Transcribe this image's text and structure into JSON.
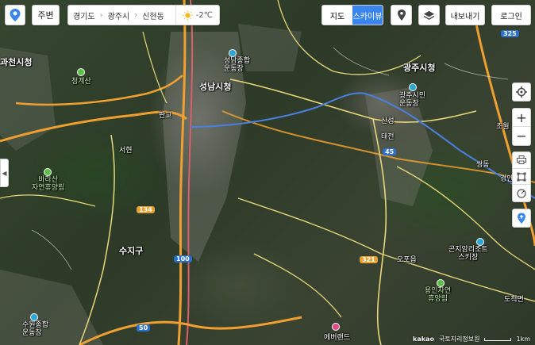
{
  "toolbar": {
    "nearby_label": "주변",
    "breadcrumb": [
      "경기도",
      "광주시",
      "신현동"
    ],
    "weather_temp": "-2℃",
    "map_types": [
      "지도",
      "스카이뷰"
    ],
    "active_map_type": "스카이뷰",
    "export_label": "내보내기",
    "login_label": "로그인"
  },
  "places": {
    "gwacheon": "과천시청",
    "cheonggyesan": "청계산",
    "seongnam_hall": "성남시청",
    "seongnam_stadium": "성남종합\n운동장",
    "gwangju_hall": "광주시청",
    "gwangju_stadium": "광주시민\n운동장",
    "baragisan": "바라산\n자연휴양림",
    "suji": "수지구",
    "gonjiam": "곤지암리조트\n스키장",
    "yongin": "용인자연\n휴양림",
    "suwon_stadium": "수원종합\n운동장",
    "everland": "에버랜드",
    "pangyo": "판교",
    "seohyeon": "서현",
    "sinchon": "신촌",
    "sanseong": "산성",
    "taejeon": "태전",
    "gyeongan": "경안",
    "chopyeong": "초월",
    "docheok": "도척면",
    "ocheon": "오포읍",
    "ssangdong": "쌍동"
  },
  "roads": {
    "r1": "325",
    "r2": "100",
    "r3": "45",
    "r4": "321",
    "r5": "50",
    "r6": "134"
  },
  "footer": {
    "brand": "kakao",
    "copyright": "국토지리정보원",
    "scale": "1km"
  },
  "colors": {
    "accent": "#3b86ee",
    "highway": "#f0a030",
    "road": "#e8d77a",
    "route": "#4b7fe0"
  }
}
